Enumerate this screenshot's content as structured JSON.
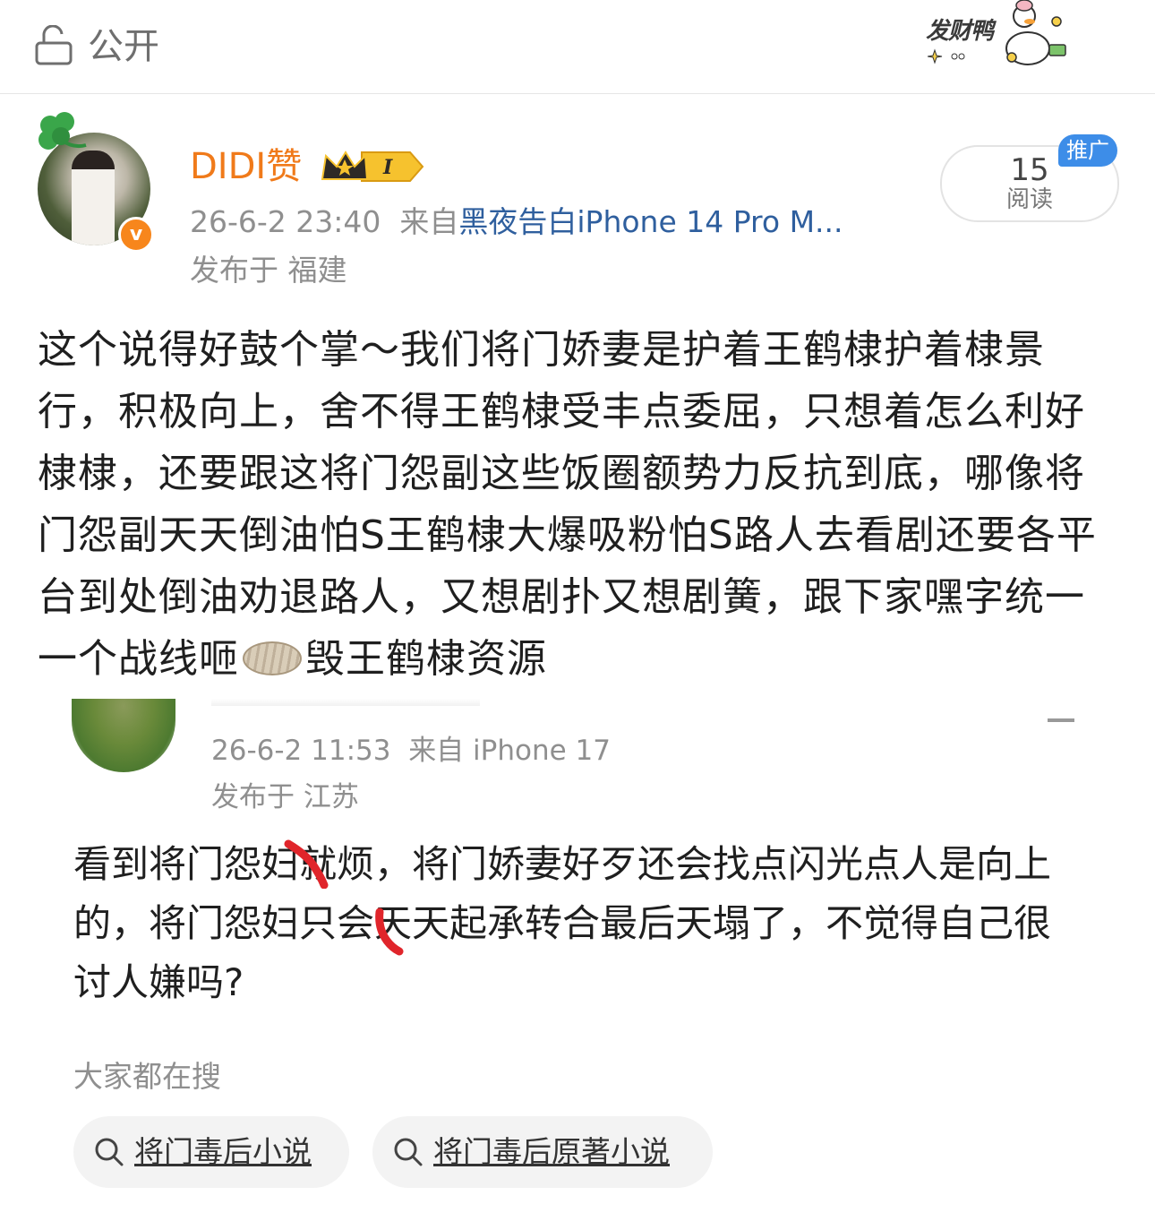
{
  "header": {
    "privacy_label": "公开",
    "sticker_text": "发财鸭"
  },
  "post": {
    "username": "DIDI赞",
    "vip_level": "I",
    "timestamp": "26-6-2 23:40",
    "source_prefix": "来自",
    "source_name": "黑夜告白iPhone 14 Pro M...",
    "location": "发布于 福建",
    "read_count": "15",
    "read_label": "阅读",
    "promo_badge": "推广",
    "body_part1": "这个说得好鼓个掌～我们将门娇妻是护着王鹤棣护着棣景行，积极向上，舍不得王鹤棣受丰点委屈，只想着怎么利好棣棣，还要跟这将门怨副这些饭圈额势力反抗到底，哪像将门怨副天天倒油怕S王鹤棣大爆吸粉怕S路人去看剧还要各平台到处倒油劝退路人，又想剧扑又想剧簧，跟下家嘿字统一一个战线咂",
    "body_part2": "毁王鹤棣资源"
  },
  "quoted": {
    "timestamp": "26-6-2 11:53",
    "source_prefix": "来自",
    "source_name": "iPhone 17",
    "location": "发布于 江苏",
    "body": "看到将门怨妇就烦，将门娇妻好歹还会找点闪光点人是向上的，将门怨妇只会天天起承转合最后天塌了，不觉得自己很讨人嫌吗?"
  },
  "search": {
    "title": "大家都在搜",
    "chips": [
      {
        "label": "将门毒后小说"
      },
      {
        "label": "将门毒后原著小说"
      }
    ]
  },
  "colors": {
    "username": "#f07a1a",
    "source_link": "#2f5f9e",
    "promo": "#3d8de8",
    "verified": "#f7861c"
  }
}
